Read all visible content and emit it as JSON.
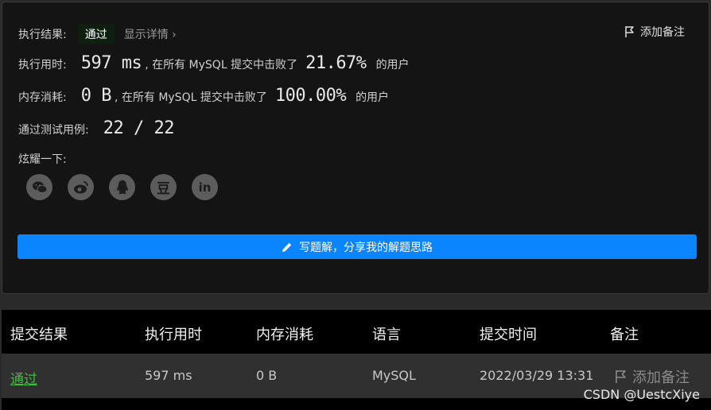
{
  "result": {
    "label": "执行结果:",
    "status": "通过",
    "details_link": "显示详情",
    "add_note": "添加备注"
  },
  "runtime": {
    "label": "执行用时:",
    "value": "597 ms",
    "mid_text": ", 在所有 MySQL 提交中击败了",
    "percent": "21.67%",
    "tail": "的用户"
  },
  "memory": {
    "label": "内存消耗:",
    "value": "0 B",
    "mid_text": ", 在所有 MySQL 提交中击败了",
    "percent": "100.00%",
    "tail": "的用户"
  },
  "tests": {
    "label": "通过测试用例:",
    "value": "22 / 22"
  },
  "share": {
    "label": "炫耀一下:",
    "icons": [
      "wechat-icon",
      "weibo-icon",
      "qq-icon",
      "douban-icon",
      "linkedin-icon"
    ],
    "douban_glyph": "豆",
    "linkedin_glyph": "in"
  },
  "write_solution": {
    "label": "写题解，分享我的解题思路"
  },
  "table": {
    "headers": [
      "提交结果",
      "执行用时",
      "内存消耗",
      "语言",
      "提交时间",
      "备注"
    ],
    "row": {
      "status": "通过",
      "runtime": "597 ms",
      "memory": "0 B",
      "language": "MySQL",
      "time": "2022/03/29 13:31",
      "note": "添加备注"
    }
  },
  "watermark": "CSDN @UestcXiye",
  "colors": {
    "accent": "#0a84ff",
    "pass": "#3fbf3f",
    "card_bg": "#141414"
  }
}
